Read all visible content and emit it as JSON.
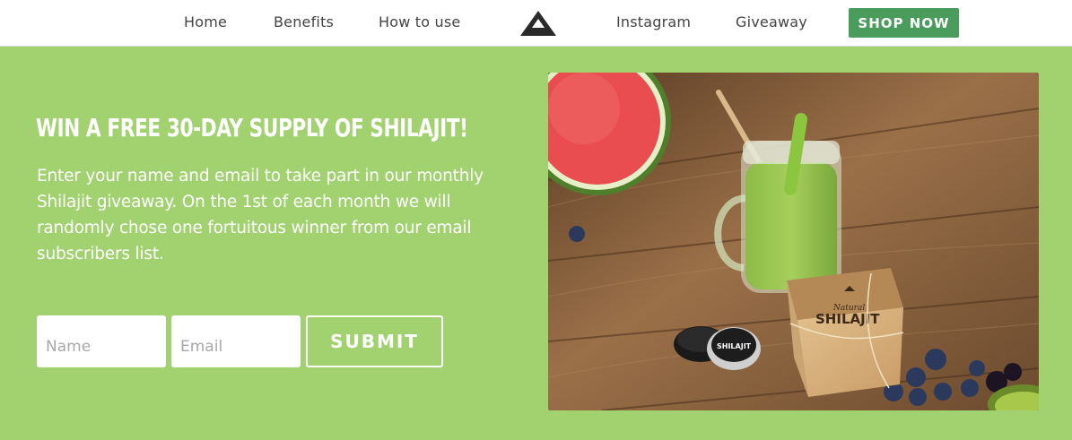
{
  "nav": {
    "links": [
      "Home",
      "Benefits",
      "How to use",
      "Instagram",
      "Giveaway"
    ],
    "shop_label": "SHOP NOW"
  },
  "hero": {
    "headline": "WIN A FREE 30-DAY SUPPLY OF SHILAJIT!",
    "description": "Enter your name and email to take part in our monthly Shilajit giveaway. On the 1st of each month we will randomly chose one fortuitous winner from our email subscribers list.",
    "form": {
      "name_placeholder": "Name",
      "email_placeholder": "Email",
      "submit_label": "SUBMIT"
    }
  },
  "photo": {
    "box_brand_small": "Natural",
    "box_brand": "SHILAJIT",
    "jar_label": "SHILAJIT"
  },
  "colors": {
    "background": "#a1d26f",
    "shop_button": "#4a9c5c",
    "nav_background": "#ffffff"
  }
}
